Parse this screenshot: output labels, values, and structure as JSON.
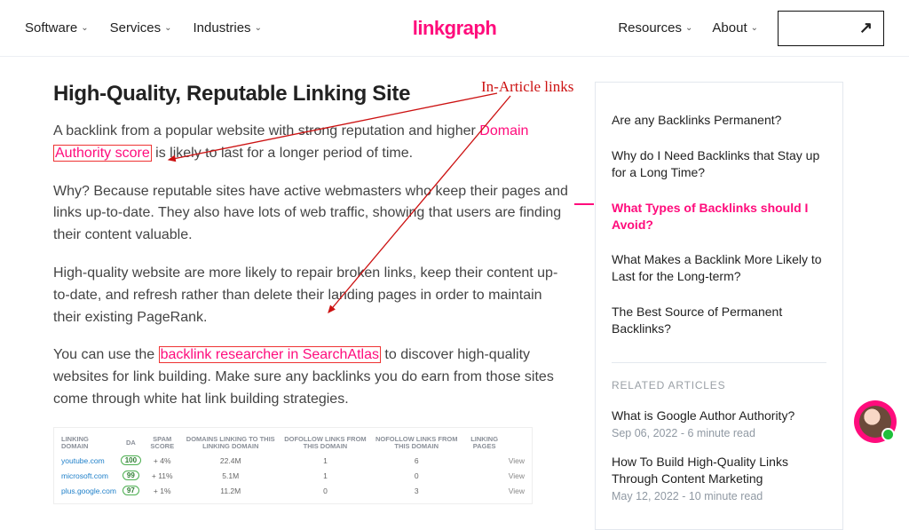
{
  "nav": {
    "left": [
      "Software",
      "Services",
      "Industries"
    ],
    "right": [
      "Resources",
      "About"
    ],
    "logo": "linkgraph"
  },
  "article": {
    "heading": "High-Quality, Reputable Linking Site",
    "p1_a": "A backlink from a popular website with strong reputation and higher ",
    "p1_link1_a": "Domain",
    "p1_link1_b": "Authority score",
    "p1_b": " is likely to last for a longer period of time.",
    "p2": "Why? Because reputable sites have active webmasters who keep their pages and links up-to-date. They also have lots of web traffic, showing that users are finding their content valuable.",
    "p3": "High-quality website are more likely to repair broken links, keep their content up-to-date, and refresh rather than delete their landing pages in order to maintain their existing PageRank.",
    "p4_a": "You can use the ",
    "p4_link": "backlink researcher in SearchAtlas",
    "p4_b": " to discover high-quality websites for link building. Make sure any backlinks you do earn from those sites come through white hat link building strategies."
  },
  "table": {
    "headers": [
      "LINKING DOMAIN",
      "DA",
      "SPAM SCORE",
      "DOMAINS LINKING TO THIS LINKING DOMAIN",
      "DOFOLLOW LINKS FROM THIS DOMAIN",
      "NOFOLLOW LINKS FROM THIS DOMAIN",
      "LINKING PAGES",
      ""
    ],
    "rows": [
      {
        "domain": "youtube.com",
        "da": "100",
        "spam": "+ 4%",
        "dlinks": "22.4M",
        "df": "1",
        "nf": "6",
        "lp": "",
        "view": "View"
      },
      {
        "domain": "microsoft.com",
        "da": "99",
        "spam": "+ 11%",
        "dlinks": "5.1M",
        "df": "1",
        "nf": "0",
        "lp": "",
        "view": "View"
      },
      {
        "domain": "plus.google.com",
        "da": "97",
        "spam": "+ 1%",
        "dlinks": "11.2M",
        "df": "0",
        "nf": "3",
        "lp": "",
        "view": "View"
      }
    ]
  },
  "sidebar": {
    "items": [
      "Are any Backlinks Permanent?",
      "Why do I Need Backlinks that Stay up for a Long Time?",
      "What Types of Backlinks should I Avoid?",
      "What Makes a Backlink More Likely to Last for the Long-term?",
      "The Best Source of Permanent Backlinks?"
    ],
    "active_index": 2,
    "related_header": "RELATED ARTICLES",
    "related": [
      {
        "title": "What is Google Author Authority?",
        "meta": "Sep 06, 2022 - 6 minute read"
      },
      {
        "title": "How To Build High-Quality Links Through Content Marketing",
        "meta": "May 12, 2022 - 10 minute read"
      }
    ]
  },
  "annotation": {
    "label": "In-Article links"
  }
}
